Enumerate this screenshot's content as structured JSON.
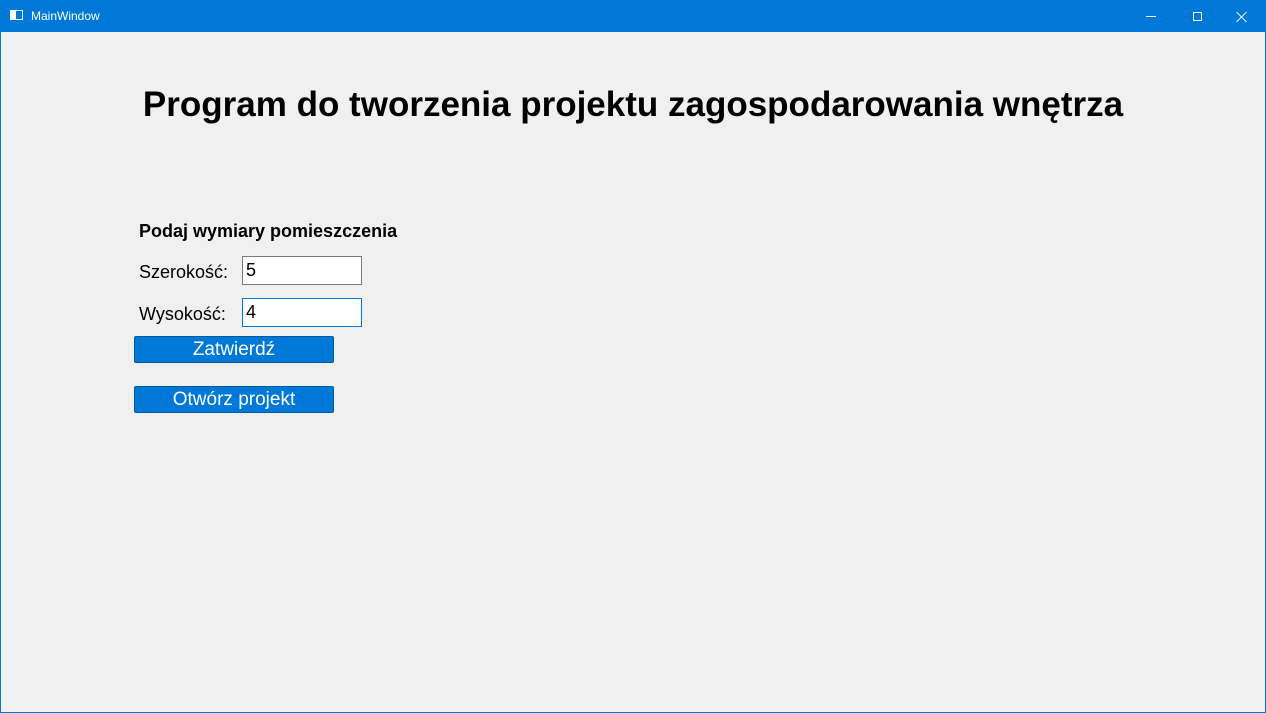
{
  "window": {
    "title": "MainWindow",
    "controls": {
      "minimize_icon": "minimize-icon",
      "maximize_icon": "maximize-icon",
      "close_icon": "close-icon"
    }
  },
  "main": {
    "heading": "Program do tworzenia projektu zagospodarowania wnętrza",
    "section_label": "Podaj wymiary pomieszczenia",
    "width_label": "Szerokość:",
    "width_value": "5",
    "height_label": "Wysokość:",
    "height_value": "4",
    "confirm_button": "Zatwierdź",
    "open_button": "Otwórz projekt"
  },
  "colors": {
    "accent": "#0078d7",
    "background": "#f0f0f0"
  }
}
